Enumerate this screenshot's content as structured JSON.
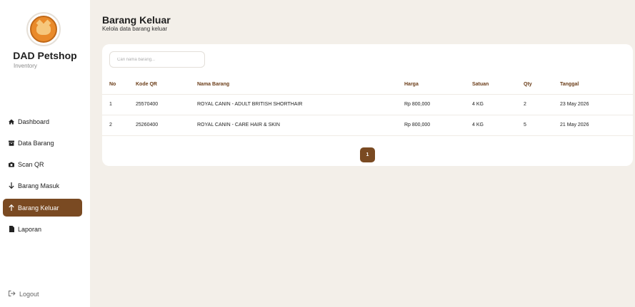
{
  "sidebar": {
    "brand": "DAD Petshop",
    "subtitle": "Inventory",
    "items": [
      {
        "label": "Dashboard",
        "icon": "home-icon"
      },
      {
        "label": "Data Barang",
        "icon": "box-icon"
      },
      {
        "label": "Scan QR",
        "icon": "camera-icon"
      },
      {
        "label": "Barang Masuk",
        "icon": "arrow-down-icon"
      },
      {
        "label": "Barang Keluar",
        "icon": "arrow-up-icon",
        "active": true
      },
      {
        "label": "Laporan",
        "icon": "file-icon"
      }
    ],
    "logout": "Logout"
  },
  "header": {
    "title": "Barang Keluar",
    "subtitle": "Kelola data barang keluar"
  },
  "search": {
    "placeholder": "Cari nama barang..."
  },
  "table": {
    "columns": [
      "No",
      "Kode QR",
      "Nama Barang",
      "Harga",
      "Satuan",
      "Qty",
      "Tanggal"
    ],
    "rows": [
      [
        "1",
        "25570400",
        "ROYAL CANIN - ADULT BRITISH SHORTHAIR",
        "Rp 800,000",
        "4 KG",
        "2",
        "23 May 2026"
      ],
      [
        "2",
        "25260400",
        "ROYAL CANIN - CARE HAIR & SKIN",
        "Rp 800,000",
        "4 KG",
        "5",
        "21 May 2026"
      ]
    ]
  },
  "pagination": {
    "current": "1"
  },
  "colors": {
    "accent": "#7a4a22",
    "background": "#f3efe9",
    "header_text": "#6b3d18"
  }
}
